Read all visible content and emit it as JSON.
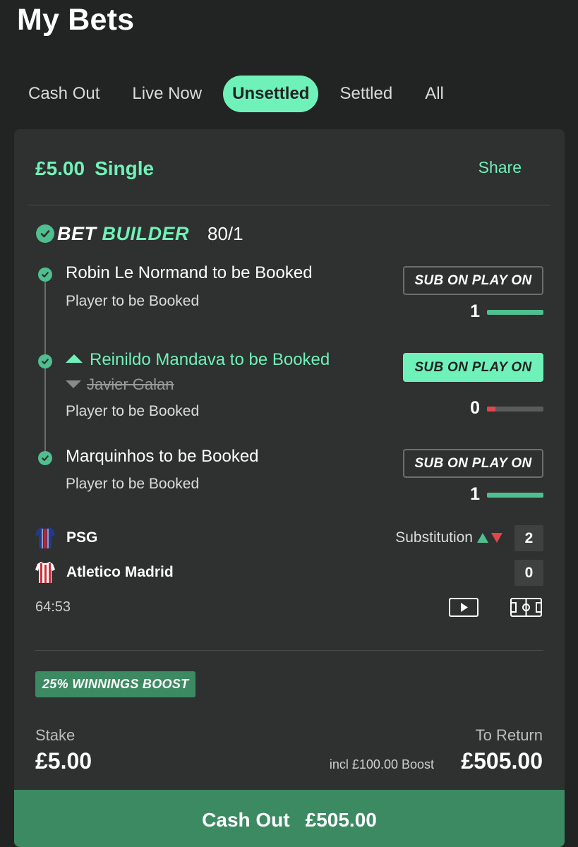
{
  "page": {
    "title": "My Bets"
  },
  "tabs": [
    {
      "label": "Cash Out",
      "active": false
    },
    {
      "label": "Live Now",
      "active": false
    },
    {
      "label": "Unsettled",
      "active": true
    },
    {
      "label": "Settled",
      "active": false
    },
    {
      "label": "All",
      "active": false
    }
  ],
  "bet": {
    "stake_title": "£5.00",
    "type": "Single",
    "share_label": "Share",
    "builder": {
      "label_bet": "BET",
      "label_builder": "BUILDER",
      "odds": "80/1"
    },
    "legs": [
      {
        "name": "Robin Le Normand to be Booked",
        "market": "Player to be Booked",
        "badge": "SUB ON PLAY ON",
        "badge_active": false,
        "count": "1",
        "progress": 1.0
      },
      {
        "name": "Reinildo Mandava to be Booked",
        "replaced": "Javier Galan",
        "market": "Player to be Booked",
        "badge": "SUB ON PLAY ON",
        "badge_active": true,
        "count": "0",
        "progress": 0.15
      },
      {
        "name": "Marquinhos to be Booked",
        "market": "Player to be Booked",
        "badge": "SUB ON PLAY ON",
        "badge_active": false,
        "count": "1",
        "progress": 1.0
      }
    ],
    "match": {
      "home": {
        "name": "PSG",
        "score": "2"
      },
      "away": {
        "name": "Atletico Madrid",
        "score": "0"
      },
      "event_label": "Substitution",
      "clock": "64:53"
    },
    "boost_badge": "25% WINNINGS BOOST",
    "stake_label": "Stake",
    "stake_value": "£5.00",
    "return_label": "To Return",
    "boost_note": "incl £100.00 Boost",
    "return_value": "£505.00",
    "cashout": {
      "label": "Cash Out",
      "amount": "£505.00"
    }
  },
  "colors": {
    "accent": "#6ff2b9",
    "cashout": "#3c8a62",
    "background": "#222323",
    "card": "#2f3030",
    "negative": "#e0474c"
  },
  "icons": [
    "check-circle-icon",
    "arrow-up-icon",
    "arrow-down-icon",
    "psg-shirt-icon",
    "atletico-shirt-icon",
    "triangle-up-icon",
    "triangle-down-icon",
    "video-icon",
    "pitch-icon"
  ]
}
